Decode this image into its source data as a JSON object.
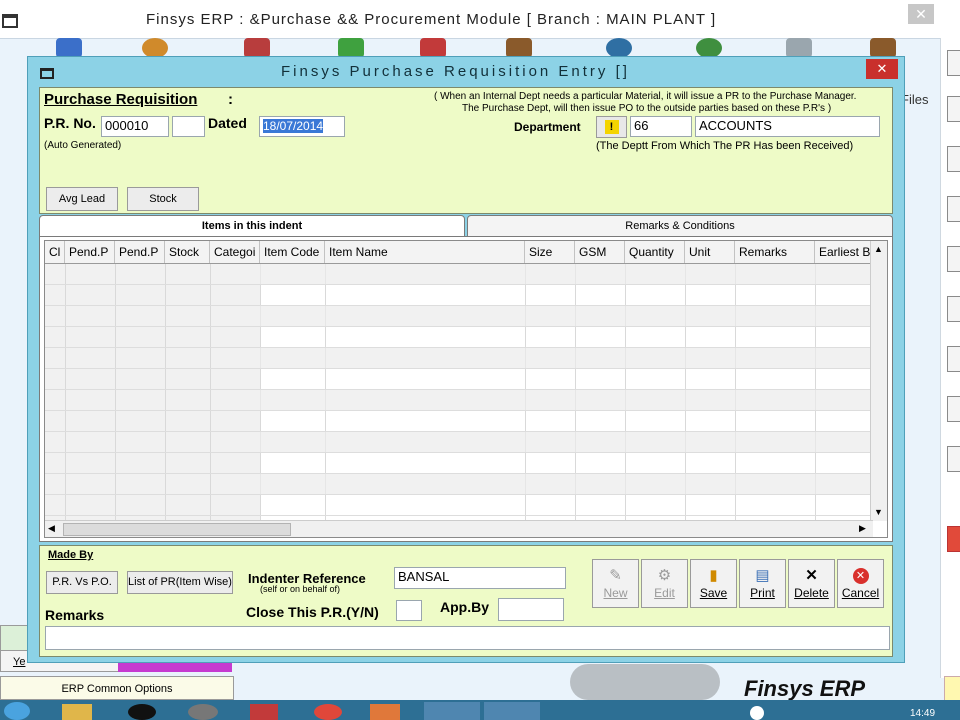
{
  "outer": {
    "title": "Finsys ERP  : &Purchase  && Procurement  Module       [ Branch : MAIN PLANT ]",
    "files_label": "Files",
    "bottom_left_items": [
      "Ye",
      "ERP Common Options"
    ],
    "logo_text": "Finsys ERP",
    "clock": "14:49"
  },
  "dialog": {
    "title": "Finsys Purchase Requisition Entry []",
    "heading": "Purchase Requisition",
    "heading_colon": ":",
    "pr_no_label": "P.R. No.",
    "pr_no_value": "000010",
    "pr_extra_value": "",
    "dated_label": "Dated",
    "dated_value": "18/07/2014",
    "auto_generated": "(Auto Generated)",
    "info_line1": "( When an Internal Dept needs a particular Material, it will issue a PR to the Purchase Manager.",
    "info_line2": "The Purchase Dept, will then issue PO to the outside parties based on these  P.R's )",
    "department_label": "Department",
    "department_code": "66",
    "department_name": "ACCOUNTS",
    "department_hint": "(The Deptt From Which The PR Has been Received)",
    "avg_lead_button": "Avg Lead",
    "stock_button": "Stock",
    "tabs": [
      "Items in this indent",
      "Remarks & Conditions"
    ],
    "columns": [
      "Cl",
      "Pend.P",
      "Pend.P",
      "Stock",
      "Categoi",
      "Item Code",
      "Item Name",
      "Size",
      "GSM",
      "Quantity",
      "Unit",
      "Remarks",
      "Earliest B"
    ],
    "made_by_label": "Made By",
    "pr_vs_po_button": "P.R. Vs P.O.",
    "list_pr_button": "List of PR(Item Wise)",
    "indenter_label": "Indenter Reference",
    "indenter_sub": "(self or on behalf of)",
    "indenter_value": "BANSAL",
    "remarks_label": "Remarks",
    "close_pr_label": "Close This P.R.(Y/N)",
    "close_pr_value": "",
    "app_by_label": "App.By",
    "app_by_value": "",
    "remarks_value": "",
    "toolbar": {
      "new": "New",
      "edit": "Edit",
      "save": "Save",
      "print": "Print",
      "delete": "Delete",
      "cancel": "Cancel"
    }
  },
  "colors": {
    "dialog_bg": "#8cd2e6",
    "panel_bg": "#eefbc7",
    "date_selected": "#3a78d6"
  }
}
